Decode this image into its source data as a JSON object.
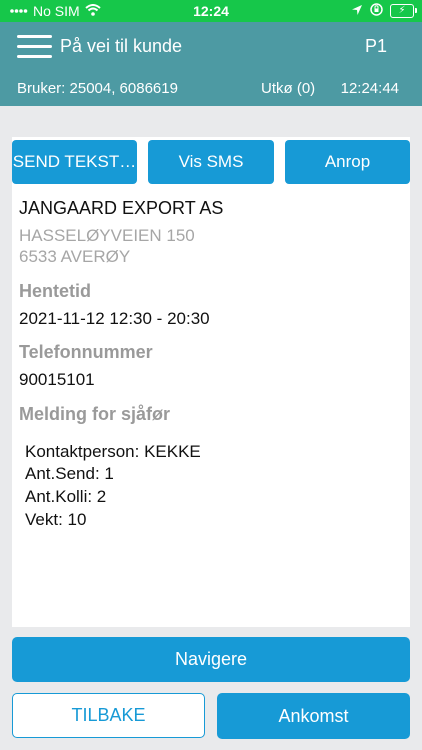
{
  "status_bar": {
    "carrier": "No SIM",
    "time": "12:24",
    "battery_icon": "charging-battery-icon"
  },
  "header": {
    "title": "På vei til kunde",
    "priority": "P1",
    "user": "Bruker: 25004, 6086619",
    "outbox": "Utkø (0)",
    "clock": "12:24:44"
  },
  "actions": {
    "send_text": "SEND TEKST…",
    "show_sms": "Vis SMS",
    "call": "Anrop"
  },
  "customer": {
    "name": "JANGAARD EXPORT AS",
    "address_line1": "HASSELØYVEIEN 150",
    "address_line2": "6533 AVERØY"
  },
  "pickup": {
    "label": "Hentetid",
    "value": "2021-11-12 12:30 - 20:30"
  },
  "phone": {
    "label": "Telefonnummer",
    "value": "90015101"
  },
  "driver_message": {
    "label": "Melding for sjåfør",
    "lines": [
      "Kontaktperson: KEKKE",
      "Ant.Send: 1",
      "Ant.Kolli: 2",
      "Vekt: 10"
    ]
  },
  "footer": {
    "navigate": "Navigere",
    "back": "TILBAKE",
    "arrival": "Ankomst"
  },
  "colors": {
    "status_bar": "#16c74a",
    "header": "#4d9aa3",
    "primary_button": "#179ad6"
  }
}
